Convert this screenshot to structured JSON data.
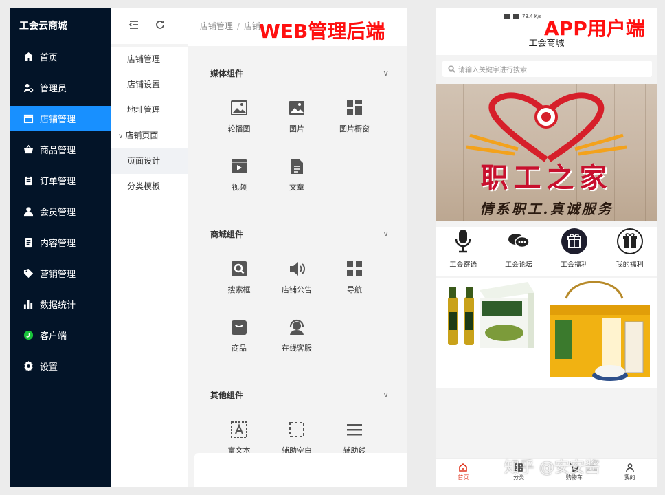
{
  "web": {
    "label": "WEB管理后端",
    "brand": "工会云商城",
    "sidebar": [
      {
        "label": "首页",
        "icon": "home-icon"
      },
      {
        "label": "管理员",
        "icon": "admin-user-icon"
      },
      {
        "label": "店铺管理",
        "icon": "store-icon",
        "active": true
      },
      {
        "label": "商品管理",
        "icon": "basket-icon"
      },
      {
        "label": "订单管理",
        "icon": "clipboard-icon"
      },
      {
        "label": "会员管理",
        "icon": "member-icon"
      },
      {
        "label": "内容管理",
        "icon": "document-icon"
      },
      {
        "label": "营销管理",
        "icon": "tag-icon"
      },
      {
        "label": "数据统计",
        "icon": "bar-chart-icon"
      },
      {
        "label": "客户端",
        "icon": "client-icon"
      },
      {
        "label": "设置",
        "icon": "gear-icon"
      }
    ],
    "submenu": [
      "店铺管理",
      "店铺设置",
      "地址管理",
      "店铺页面",
      "页面设计",
      "分类模板"
    ],
    "breadcrumb": [
      "店铺管理",
      "店铺"
    ],
    "sections": [
      {
        "title": "媒体组件",
        "items": [
          {
            "label": "轮播图",
            "icon": "carousel-icon"
          },
          {
            "label": "图片",
            "icon": "image-icon"
          },
          {
            "label": "图片橱窗",
            "icon": "image-window-icon"
          },
          {
            "label": "视频",
            "icon": "video-icon"
          },
          {
            "label": "文章",
            "icon": "article-icon"
          }
        ]
      },
      {
        "title": "商城组件",
        "items": [
          {
            "label": "搜索框",
            "icon": "search-box-icon"
          },
          {
            "label": "店铺公告",
            "icon": "speaker-icon"
          },
          {
            "label": "导航",
            "icon": "navigation-icon"
          },
          {
            "label": "商品",
            "icon": "goods-icon"
          },
          {
            "label": "在线客服",
            "icon": "customer-service-icon"
          }
        ]
      },
      {
        "title": "其他组件",
        "items": [
          {
            "label": "富文本",
            "icon": "rich-text-icon"
          },
          {
            "label": "辅助空白",
            "icon": "blank-space-icon"
          },
          {
            "label": "辅助线",
            "icon": "divider-line-icon"
          }
        ]
      }
    ]
  },
  "app": {
    "label": "APP用户端",
    "status": "73.4 K/s",
    "title": "工会商城",
    "search_placeholder": "请输入关键字进行搜索",
    "banner_title": "职工之家",
    "banner_slogan": "情系职工.真诚服务",
    "shortcuts": [
      {
        "label": "工会寄语",
        "icon": "microphone-icon"
      },
      {
        "label": "工会论坛",
        "icon": "chat-bubbles-icon"
      },
      {
        "label": "工会福利",
        "icon": "gift-icon"
      },
      {
        "label": "我的福利",
        "icon": "gift-box-icon"
      }
    ],
    "tabs": [
      {
        "label": "首页",
        "icon": "home-tab-icon",
        "active": true
      },
      {
        "label": "分类",
        "icon": "category-icon"
      },
      {
        "label": "购物车",
        "icon": "cart-icon"
      },
      {
        "label": "我的",
        "icon": "profile-icon"
      }
    ],
    "watermark": "知乎 @安安酱"
  },
  "colors": {
    "sidebar_bg": "#031428",
    "active_blue": "#1890ff",
    "label_red": "#ff1010",
    "tab_active": "#e0341e"
  }
}
